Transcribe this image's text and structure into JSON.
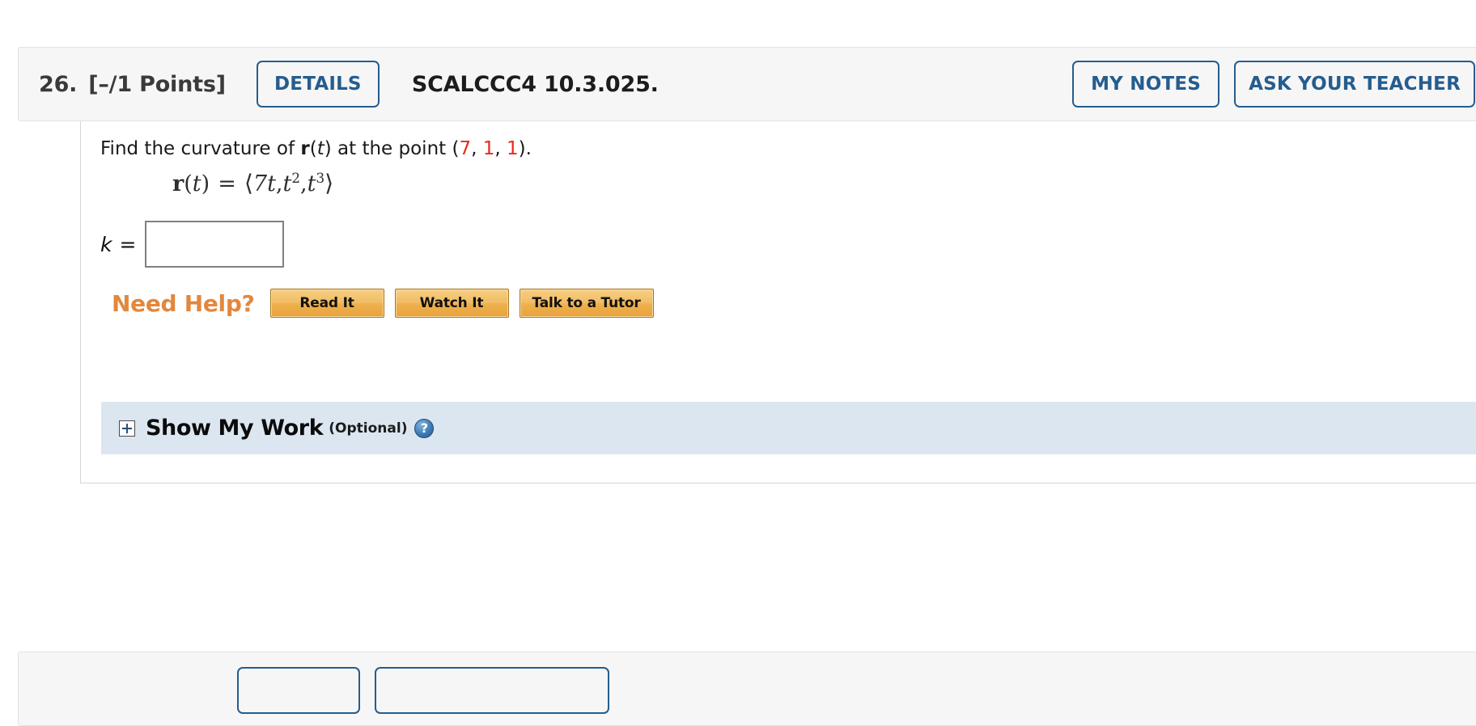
{
  "question": {
    "number": "26.",
    "points": "[–/1 Points]",
    "details_label": "DETAILS",
    "code": "SCALCCC4 10.3.025.",
    "my_notes_label": "MY NOTES",
    "ask_teacher_label": "ASK YOUR TEACHER"
  },
  "prompt": {
    "part1": "Find the curvature of ",
    "vector_name": "r",
    "paren_open": "(",
    "variable": "t",
    "paren_close": ")",
    "part2": " at the point (",
    "coord_x": "7",
    "sep1": ", ",
    "coord_y": "1",
    "sep2": ", ",
    "coord_z": "1",
    "part3": ")."
  },
  "formula": {
    "lhs_vector": "r",
    "lhs_open": "(",
    "lhs_var": "t",
    "lhs_close": ")",
    "equals": "=",
    "bracket_open": "⟨",
    "term1_coef": "7",
    "term1_var": "t",
    "comma1": ",",
    "term2_var": "t",
    "term2_exp": "2",
    "comma2": ",",
    "term3_var": "t",
    "term3_exp": "3",
    "bracket_close": "⟩"
  },
  "answer": {
    "label_symbol": "k",
    "label_equals": "=",
    "value": "",
    "placeholder": ""
  },
  "need_help": {
    "label": "Need Help?",
    "buttons": [
      {
        "label": "Read It"
      },
      {
        "label": "Watch It"
      },
      {
        "label": "Talk to a Tutor"
      }
    ]
  },
  "show_my_work": {
    "title": "Show My Work",
    "optional": "(Optional)",
    "help_glyph": "?"
  },
  "colors": {
    "accent_blue": "#255d8e",
    "coordinate_red": "#e8291c",
    "need_help_orange": "#e3873c",
    "show_my_work_bg": "#dce6f0",
    "header_bg": "#f6f6f6"
  }
}
